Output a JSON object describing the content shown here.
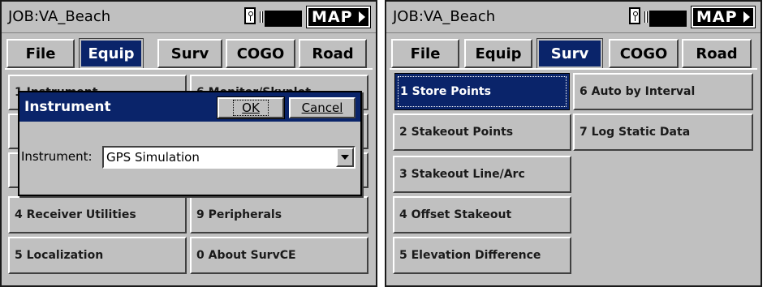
{
  "left": {
    "job_title": "JOB:VA_Beach",
    "map_label": "MAP",
    "tabs": [
      {
        "label": "File"
      },
      {
        "label": "Equip"
      },
      {
        "label": "Surv"
      },
      {
        "label": "COGO"
      },
      {
        "label": "Road"
      }
    ],
    "active_tab": "Equip",
    "menu": [
      {
        "label": "1 Instrument"
      },
      {
        "label": "6 Monitor/Skyplot"
      },
      {
        "label": "4 Receiver Utilities"
      },
      {
        "label": "9 Peripherals"
      },
      {
        "label": "5 Localization"
      },
      {
        "label": "0 About SurvCE"
      }
    ],
    "dialog": {
      "title": "Instrument",
      "ok_label": "OK",
      "cancel_label": "Cancel",
      "field_label": "Instrument:",
      "field_value": "GPS Simulation"
    }
  },
  "right": {
    "job_title": "JOB:VA_Beach",
    "map_label": "MAP",
    "tabs": [
      {
        "label": "File"
      },
      {
        "label": "Equip"
      },
      {
        "label": "Surv"
      },
      {
        "label": "COGO"
      },
      {
        "label": "Road"
      }
    ],
    "active_tab": "Surv",
    "menu": [
      {
        "label": "1 Store Points"
      },
      {
        "label": "6 Auto by Interval"
      },
      {
        "label": "2 Stakeout Points"
      },
      {
        "label": "7 Log Static Data"
      },
      {
        "label": "3 Stakeout Line/Arc"
      },
      {
        "label": "4 Offset Stakeout"
      },
      {
        "label": "5 Elevation Difference"
      }
    ],
    "selected_item": "1 Store Points"
  },
  "colors": {
    "window_bg": "#c0c0c0",
    "selection": "#0a246a",
    "text": "#000000",
    "highlight_text": "#ffffff"
  },
  "icons": [
    "gps-status-icon",
    "battery-bar-icon",
    "map-arrow-icon",
    "dropdown-arrow-icon"
  ]
}
